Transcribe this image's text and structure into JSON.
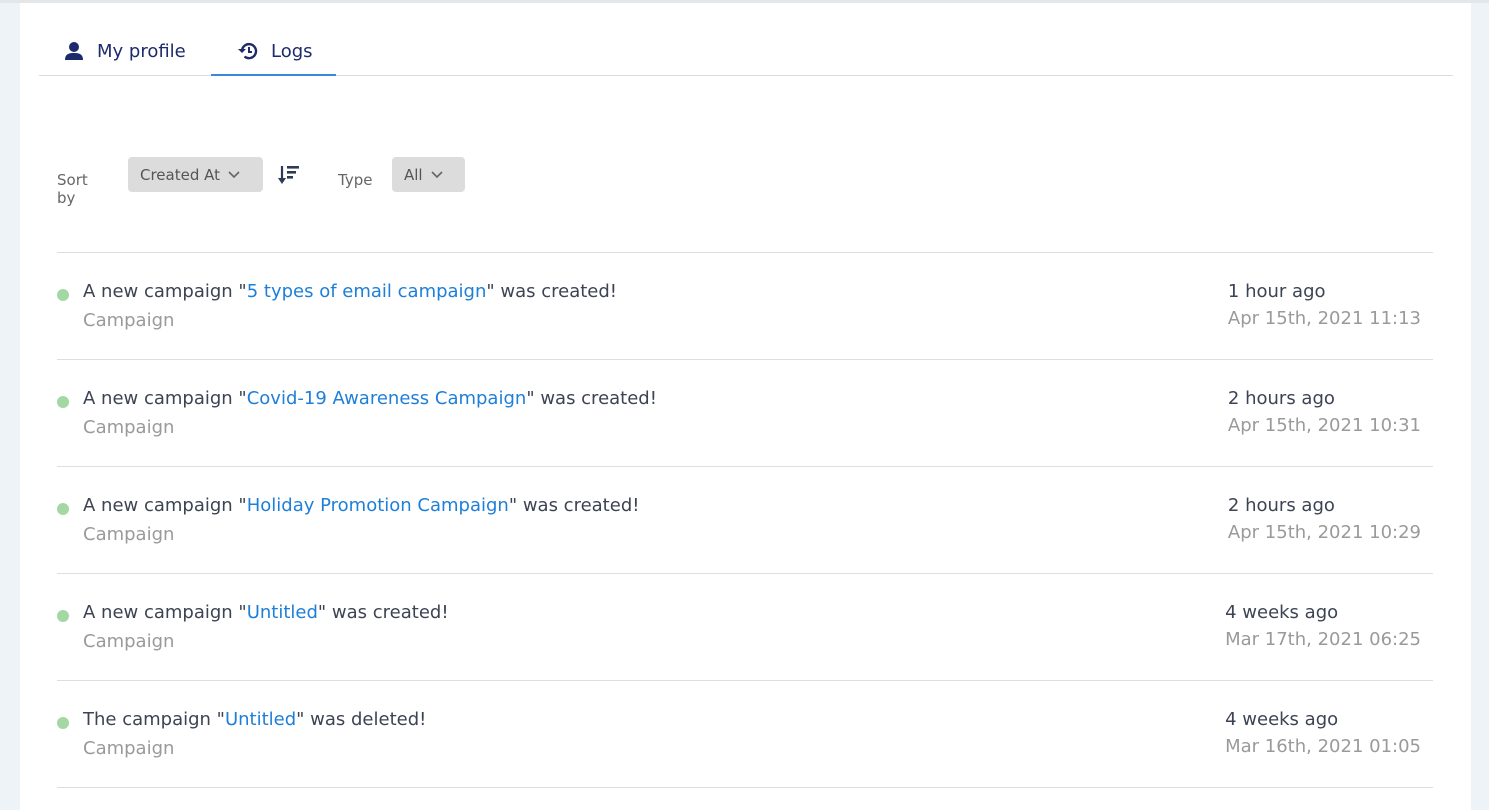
{
  "tabs": [
    {
      "label": "My profile",
      "icon": "user-icon",
      "active": false
    },
    {
      "label": "Logs",
      "icon": "history-icon",
      "active": true
    }
  ],
  "filters": {
    "sort_label": "Sort by",
    "sort_value": "Created At",
    "sort_direction": "descending",
    "type_label": "Type",
    "type_value": "All"
  },
  "logs": [
    {
      "prefix": "A new campaign \"",
      "link": "5 types of email campaign",
      "suffix": "\" was created!",
      "type": "Campaign",
      "ago": "1 hour ago",
      "date": "Apr 15th, 2021 11:13",
      "status_color": "#a3d8a3"
    },
    {
      "prefix": "A new campaign \"",
      "link": "Covid-19 Awareness Campaign",
      "suffix": "\" was created!",
      "type": "Campaign",
      "ago": "2 hours ago",
      "date": "Apr 15th, 2021 10:31",
      "status_color": "#a3d8a3"
    },
    {
      "prefix": "A new campaign \"",
      "link": "Holiday Promotion Campaign",
      "suffix": "\" was created!",
      "type": "Campaign",
      "ago": "2 hours ago",
      "date": "Apr 15th, 2021 10:29",
      "status_color": "#a3d8a3"
    },
    {
      "prefix": "A new campaign \"",
      "link": "Untitled",
      "suffix": "\" was created!",
      "type": "Campaign",
      "ago": "4 weeks ago",
      "date": "Mar 17th, 2021 06:25",
      "status_color": "#a3d8a3"
    },
    {
      "prefix": "The campaign \"",
      "link": "Untitled",
      "suffix": "\" was deleted!",
      "type": "Campaign",
      "ago": "4 weeks ago",
      "date": "Mar 16th, 2021 01:05",
      "status_color": "#a3d8a3"
    }
  ]
}
